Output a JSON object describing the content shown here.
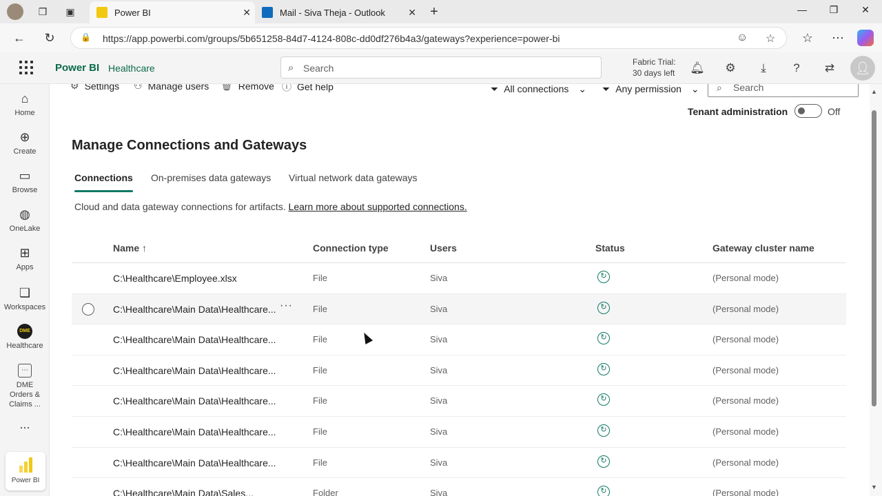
{
  "browser": {
    "tabs": [
      {
        "title": "Power BI",
        "active": true
      },
      {
        "title": "Mail - Siva Theja - Outlook",
        "active": false
      }
    ],
    "url": "https://app.powerbi.com/groups/5b651258-84d7-4124-808c-dd0df276b4a3/gateways?experience=power-bi"
  },
  "header": {
    "brand": "Power BI",
    "workspace": "Healthcare",
    "search_placeholder": "Search",
    "trial_line1": "Fabric Trial:",
    "trial_line2": "30 days left"
  },
  "leftnav": {
    "items": [
      {
        "label": "Home",
        "icon": "home-icon"
      },
      {
        "label": "Create",
        "icon": "create-icon"
      },
      {
        "label": "Browse",
        "icon": "browse-icon"
      },
      {
        "label": "OneLake",
        "icon": "onelake-icon"
      },
      {
        "label": "Apps",
        "icon": "apps-icon"
      },
      {
        "label": "Workspaces",
        "icon": "workspaces-icon"
      },
      {
        "label": "Healthcare",
        "icon": "dme-icon"
      },
      {
        "label": "DME Orders & Claims ...",
        "icon": "report-icon"
      }
    ],
    "more": "...",
    "dme_badge": "DME",
    "powerbi_tile": "Power BI"
  },
  "toolbar": {
    "settings": "Settings",
    "manage_users": "Manage users",
    "remove": "Remove",
    "get_help": "Get help",
    "filter_connections": "All connections",
    "filter_permission": "Any permission",
    "search_placeholder": "Search",
    "tenant_label": "Tenant administration",
    "tenant_state": "Off"
  },
  "page": {
    "title": "Manage Connections and Gateways",
    "tabs": [
      "Connections",
      "On-premises data gateways",
      "Virtual network data gateways"
    ],
    "active_tab": 0,
    "description": "Cloud and data gateway connections for artifacts.",
    "learn_more": "Learn more about supported connections."
  },
  "table": {
    "columns": [
      "Name ↑",
      "Connection type",
      "Users",
      "Status",
      "Gateway cluster name"
    ],
    "rows": [
      {
        "name": "C:\\Healthcare\\Employee.xlsx",
        "type": "File",
        "users": "Siva",
        "gateway": "(Personal mode)"
      },
      {
        "name": "C:\\Healthcare\\Main Data\\Healthcare...",
        "type": "File",
        "users": "Siva",
        "gateway": "(Personal mode)"
      },
      {
        "name": "C:\\Healthcare\\Main Data\\Healthcare...",
        "type": "File",
        "users": "Siva",
        "gateway": "(Personal mode)"
      },
      {
        "name": "C:\\Healthcare\\Main Data\\Healthcare...",
        "type": "File",
        "users": "Siva",
        "gateway": "(Personal mode)"
      },
      {
        "name": "C:\\Healthcare\\Main Data\\Healthcare...",
        "type": "File",
        "users": "Siva",
        "gateway": "(Personal mode)"
      },
      {
        "name": "C:\\Healthcare\\Main Data\\Healthcare...",
        "type": "File",
        "users": "Siva",
        "gateway": "(Personal mode)"
      },
      {
        "name": "C:\\Healthcare\\Main Data\\Healthcare...",
        "type": "File",
        "users": "Siva",
        "gateway": "(Personal mode)"
      },
      {
        "name": "C:\\Healthcare\\Main Data\\Sales...",
        "type": "Folder",
        "users": "Siva",
        "gateway": "(Personal mode)"
      }
    ],
    "row_more": "···"
  },
  "colors": {
    "accent": "#117865",
    "brand": "#0b6a4b",
    "powerbi_yellow": "#f2c811"
  }
}
